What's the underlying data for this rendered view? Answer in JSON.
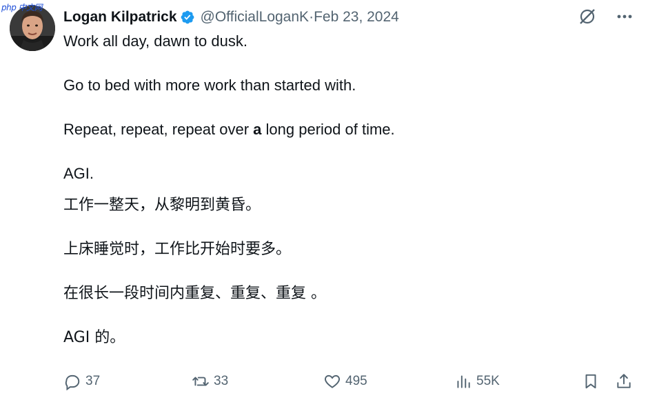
{
  "watermark": "php 中文网",
  "author": {
    "name": "Logan Kilpatrick",
    "handle": "@OfficialLoganK",
    "date": "Feb 23, 2024"
  },
  "tweet_lines": {
    "l1": "Work all day, dawn to dusk.",
    "l2": "Go to bed with more work than started with.",
    "l3_pre": "Repeat, repeat, repeat over ",
    "l3_bold": "a",
    "l3_post": " long period of time.",
    "l4": "AGI.",
    "l5": "工作一整天，从黎明到黄昏。",
    "l6": "上床睡觉时，工作比开始时要多。",
    "l7": "在很长一段时间内重复、重复、重复 。",
    "l8": "AGI 的。"
  },
  "stats": {
    "replies": "37",
    "reposts": "33",
    "likes": "495",
    "views": "55K"
  },
  "colors": {
    "text": "#0f1419",
    "muted": "#536471",
    "verified": "#1d9bf0"
  },
  "icons": [
    "grok-icon",
    "more-icon",
    "reply-icon",
    "repost-icon",
    "like-icon",
    "views-icon",
    "bookmark-icon",
    "share-icon"
  ]
}
